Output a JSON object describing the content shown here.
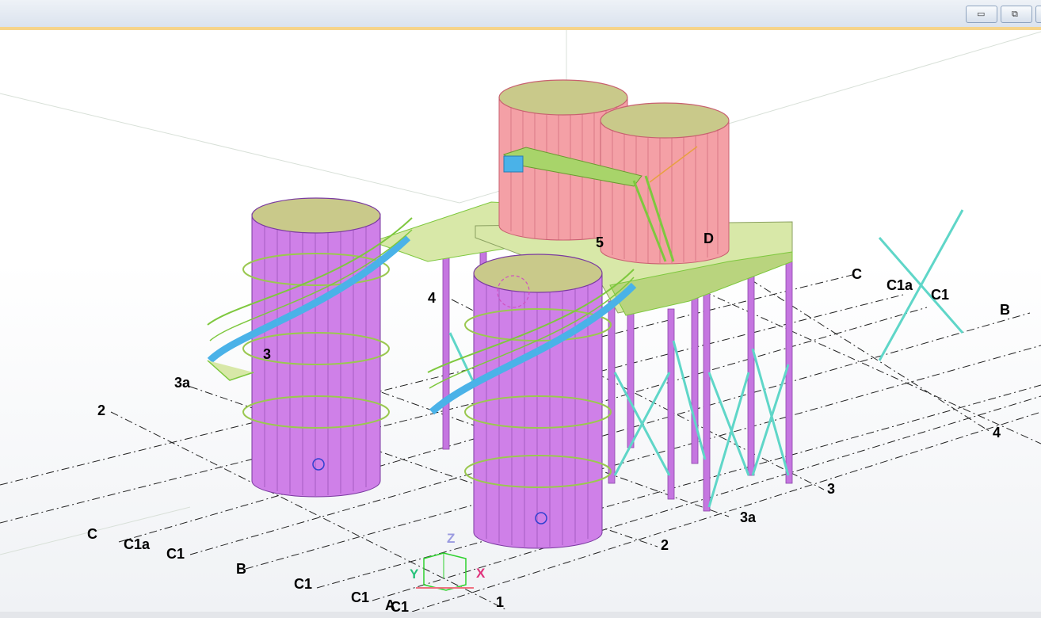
{
  "window": {
    "minimize_icon": "minimize-icon",
    "restore_icon": "restore-icon"
  },
  "grid_labels": {
    "c_right": "C",
    "c1a_right": "C1a",
    "c1_right": "C1",
    "b_right": "B",
    "n4_right": "4",
    "n3_right": "3",
    "n3a_right": "3a",
    "n2_right": "2",
    "n1_right": "1",
    "d_top": "D",
    "n5_top": "5",
    "n4_left": "4",
    "n3_left": "3",
    "n3a_left": "3a",
    "n2_left": "2",
    "c_left": "C",
    "c1a_left": "C1a",
    "c1_left": "C1",
    "b_left": "B",
    "c1_bottom1": "C1",
    "c1_bottom2": "C1",
    "a_bottom": "A",
    "c1_bottom3": "C1"
  },
  "axes": {
    "z": "Z",
    "y": "Y",
    "x": "X"
  },
  "colors": {
    "silo": "#cf80e8",
    "tank": "#f4a0a6",
    "roof": "#c9c98a",
    "platform": "#d8e8a8",
    "stair": "#7ec83e",
    "stair_treads": "#4ab2e8",
    "bracing": "#5fd6c8",
    "column": "#c576e0"
  }
}
